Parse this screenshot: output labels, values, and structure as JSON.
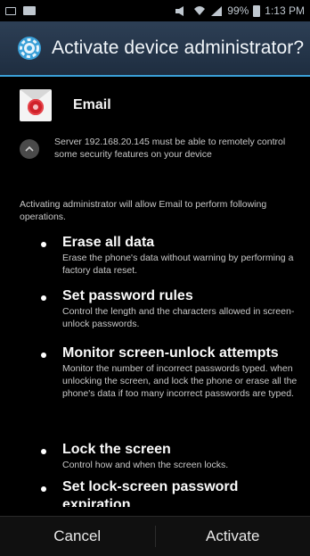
{
  "status_bar": {
    "battery": "99%",
    "time": "1:13 PM"
  },
  "title_bar": {
    "title": "Activate device administrator?"
  },
  "app": {
    "name": "Email"
  },
  "server_notice": "Server 192.168.20.145 must be able to remotely control some security features on your device",
  "intro": "Activating administrator will allow Email to perform following operations.",
  "policies": [
    {
      "title": "Erase all data",
      "desc": "Erase the phone's data without warning by performing a factory data reset."
    },
    {
      "title": "Set password rules",
      "desc": "Control the length and the characters allowed in screen-unlock passwords."
    },
    {
      "title": "Monitor screen-unlock attempts",
      "desc": "Monitor the number of incorrect passwords typed. when unlocking the screen, and lock the phone or erase all the phone's data if too many incorrect passwords are typed."
    },
    {
      "title": "Lock the screen",
      "desc": "Control how and when the screen locks."
    },
    {
      "title": "Set lock-screen password expiration",
      "desc": ""
    }
  ],
  "buttons": {
    "cancel": "Cancel",
    "activate": "Activate"
  },
  "colors": {
    "accent": "#3aa0d8",
    "title_bar": "#2d3f55"
  }
}
